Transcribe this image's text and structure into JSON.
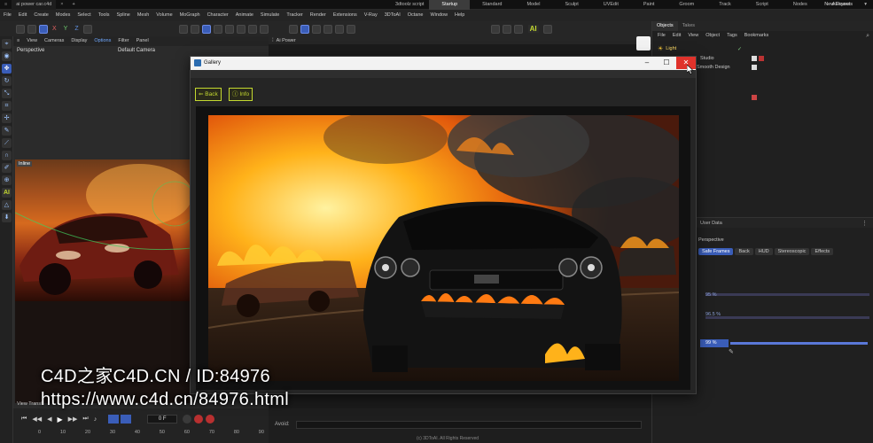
{
  "titlebar": {
    "doc_tab": "ai power car.c4d",
    "center_tabs": [
      "3dtoolz script",
      "Startup",
      "Standard",
      "Model",
      "Sculpt",
      "UVEdit",
      "Paint",
      "Groom",
      "Track",
      "Script",
      "Nodes",
      "AiPower"
    ],
    "active_tab": "Startup",
    "layouts": "New Layouts"
  },
  "menubar": [
    "File",
    "Edit",
    "Create",
    "Modes",
    "Select",
    "Tools",
    "Spline",
    "Mesh",
    "Volume",
    "MoGraph",
    "Character",
    "Animate",
    "Simulate",
    "Tracker",
    "Render",
    "Extensions",
    "V-Ray",
    "3DToAI",
    "Octane",
    "Window",
    "Help"
  ],
  "toolbar": {
    "axis_labels": [
      "X",
      "Y",
      "Z"
    ],
    "ai_badge": "AI"
  },
  "viewport": {
    "menu": [
      "View",
      "Cameras",
      "Display",
      "Options",
      "Filter",
      "Panel"
    ],
    "name": "Perspective",
    "camera": "Default Camera",
    "footer": "View Transf",
    "inset_label": "Inline"
  },
  "timeline": {
    "frame": "0 F",
    "ticks": [
      "0",
      "10",
      "20",
      "30",
      "40",
      "50",
      "60",
      "70",
      "80",
      "90"
    ]
  },
  "aipower": {
    "panel_title": "Ai Power",
    "avoid_label": "Avoid:",
    "footer": "(c) 3DToAI. All Rights Reserved"
  },
  "gallery": {
    "title": "Gallery",
    "back_label": "Back",
    "info_label": "Info",
    "accent": "#c4d930",
    "close_color": "#e0322b"
  },
  "objects": {
    "tabs": [
      "Objects",
      "Takes"
    ],
    "menu": [
      "File",
      "Edit",
      "View",
      "Object",
      "Tags",
      "Bookmarks"
    ],
    "items": [
      "Light",
      "Studio",
      "Smooth Design"
    ]
  },
  "attributes": {
    "title": "User Data",
    "mode": "Perspective",
    "tabs": [
      "Safe Frames",
      "Back",
      "HUD",
      "Stereoscopic",
      "Effects"
    ],
    "active_tab": "Safe Frames",
    "values": [
      "95 %",
      "96.5 %",
      "99 %"
    ]
  },
  "watermark": {
    "line1": "C4D之家C4D.CN / ID:84976",
    "line2": "https://www.c4d.cn/84976.html"
  }
}
